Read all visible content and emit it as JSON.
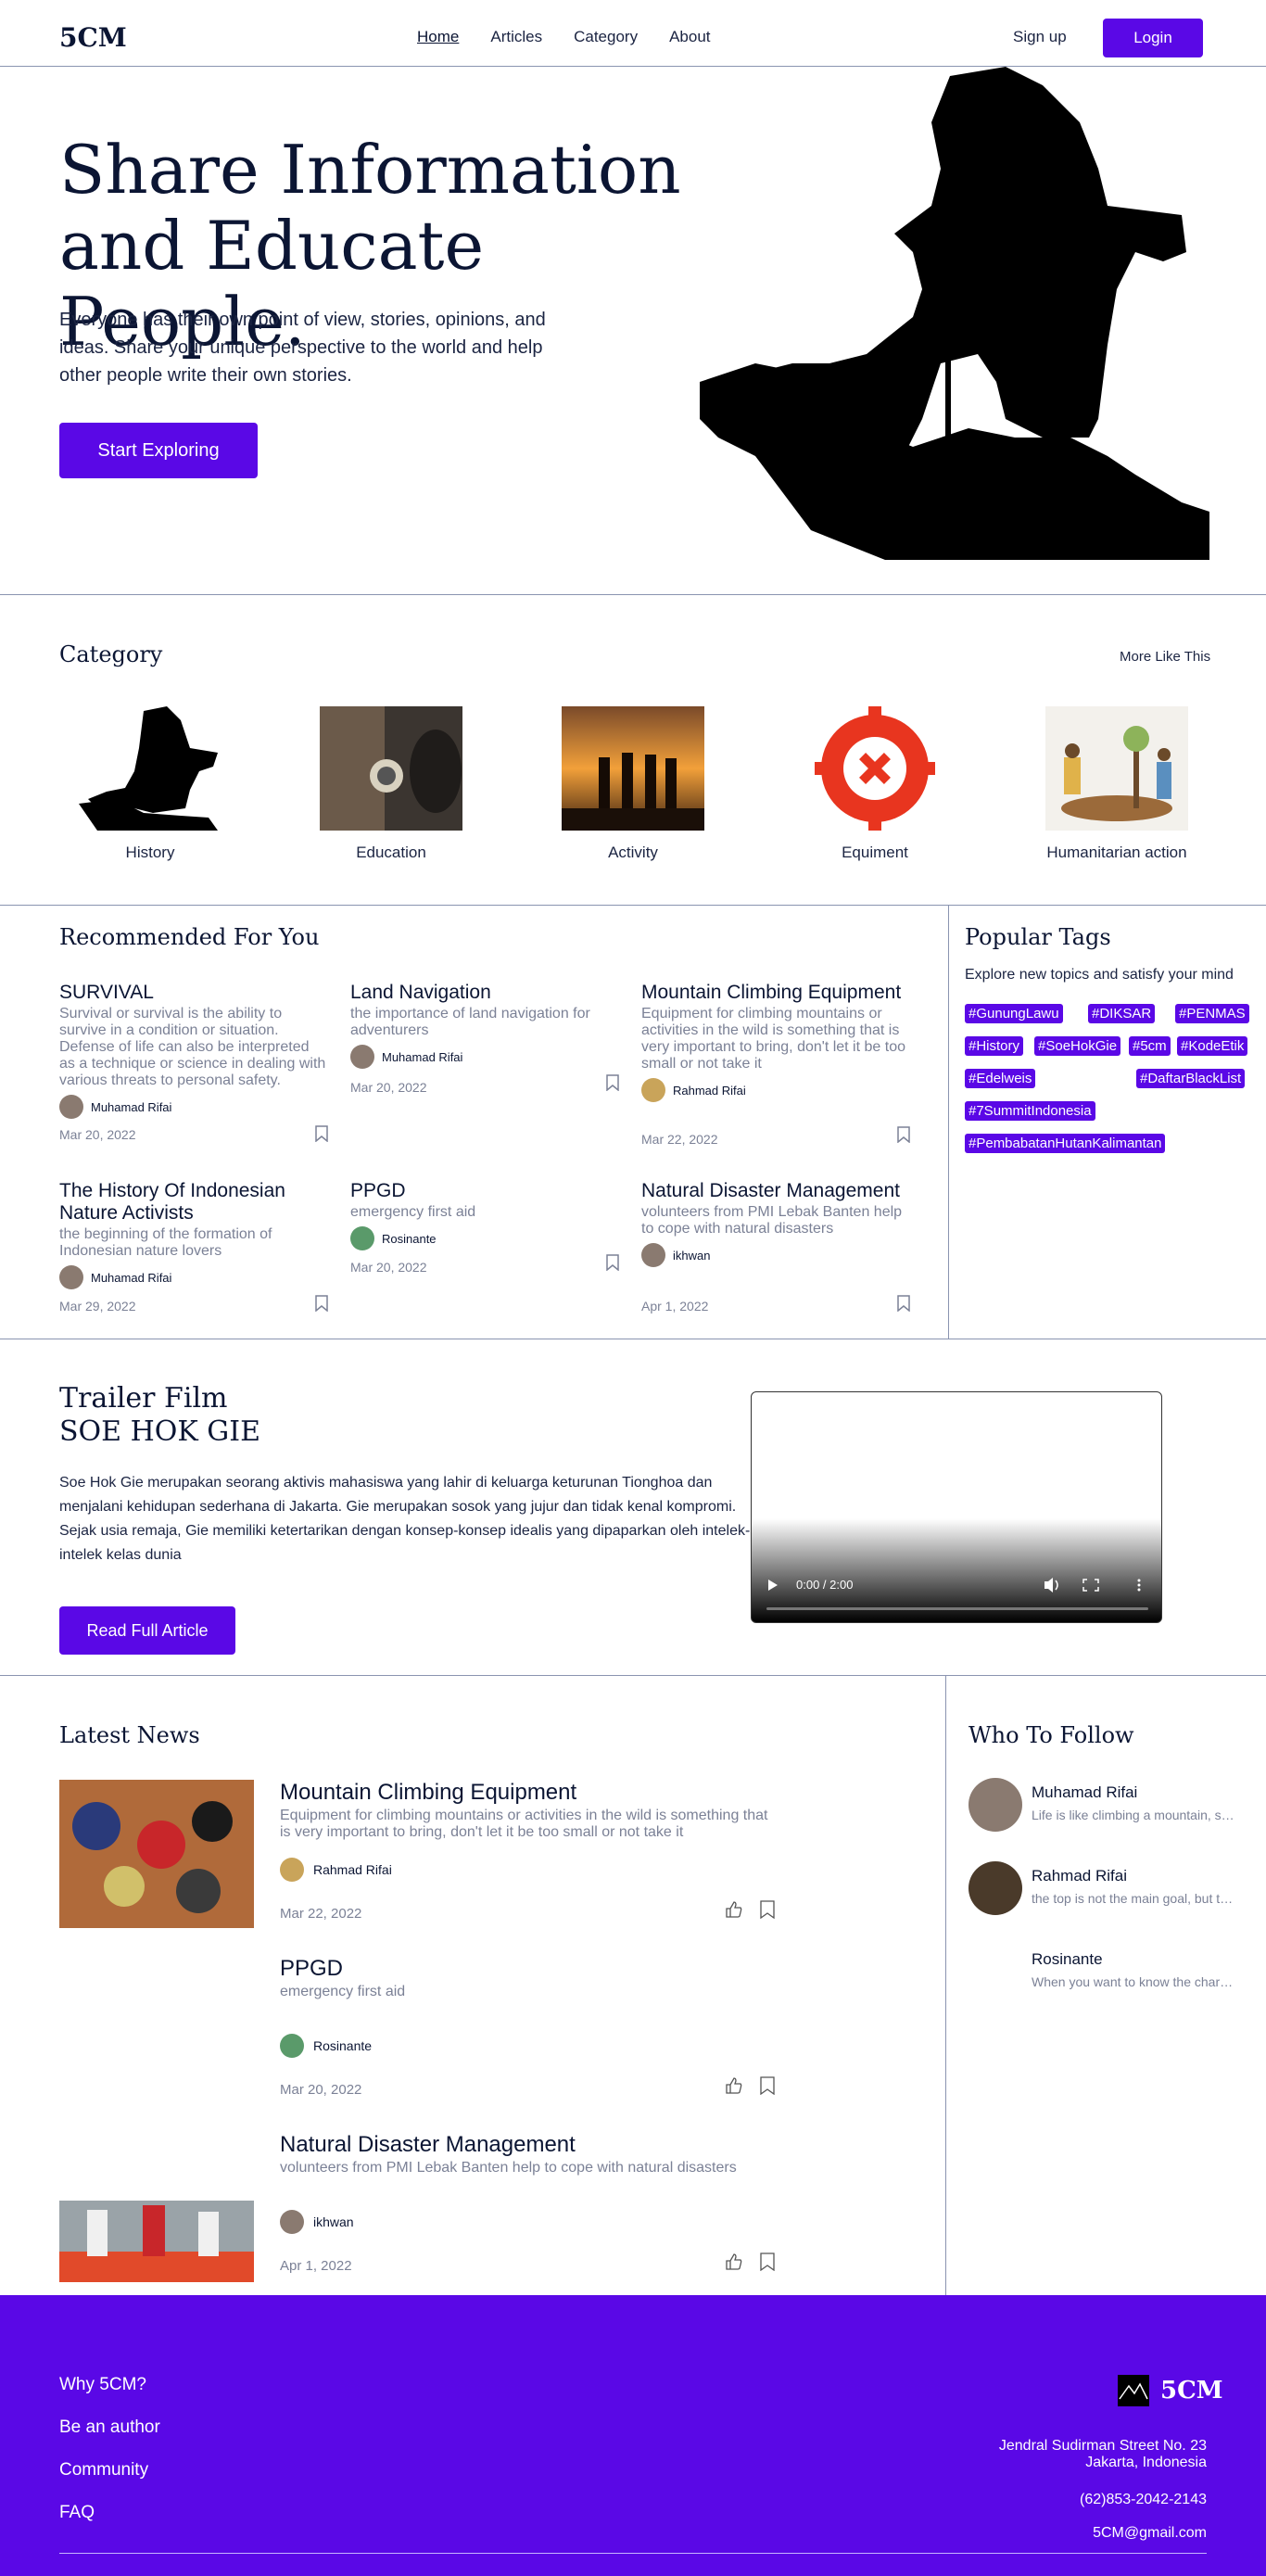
{
  "header": {
    "logo": "5CM",
    "nav": [
      "Home",
      "Articles",
      "Category",
      "About"
    ],
    "signup": "Sign up",
    "login": "Login"
  },
  "hero": {
    "title": "Share Information and Educate People.",
    "text": "Everyone has their own point of view, stories, opinions, and ideas. Share your unique perspective to the world and help other people write their own stories.",
    "button": "Start Exploring"
  },
  "category": {
    "title": "Category",
    "more": "More Like This",
    "items": [
      "History",
      "Education",
      "Activity",
      "Equiment",
      "Humanitarian action"
    ]
  },
  "recommended": {
    "title": "Recommended For You",
    "cards": [
      {
        "title": "SURVIVAL",
        "desc": "Survival or survival is the ability to survive in a condition or situation. Defense of life can also be interpreted as a technique or science in dealing with various threats to personal safety.",
        "author": "Muhamad Rifai",
        "date": "Mar 20, 2022"
      },
      {
        "title": "Land Navigation",
        "desc": "the importance of land navigation for adventurers",
        "author": "Muhamad Rifai",
        "date": "Mar 20, 2022"
      },
      {
        "title": "Mountain Climbing Equipment",
        "desc": "Equipment for climbing mountains or activities in the wild is something that is very important to bring, don't let it be too small or not take it",
        "author": "Rahmad Rifai",
        "date": "Mar 22, 2022"
      },
      {
        "title": "The History Of Indonesian Nature Activists",
        "desc": "the beginning of the formation of Indonesian nature lovers",
        "author": "Muhamad Rifai",
        "date": "Mar 29, 2022"
      },
      {
        "title": "PPGD",
        "desc": "emergency first aid",
        "author": "Rosinante",
        "date": "Mar 20, 2022"
      },
      {
        "title": "Natural Disaster Management",
        "desc": "volunteers from PMI Lebak Banten help to cope with natural disasters",
        "author": "ikhwan",
        "date": "Apr 1, 2022"
      }
    ]
  },
  "popular": {
    "title": "Popular Tags",
    "subtitle": "Explore new topics and satisfy your mind",
    "tags": [
      "#GunungLawu",
      "#DIKSAR",
      "#PENMAS",
      "#History",
      "#SoeHokGie",
      "#5cm",
      "#KodeEtik",
      "#Edelweis",
      "#DaftarBlackList",
      "#7SummitIndonesia",
      "#PembabatanHutanKalimantan"
    ]
  },
  "trailer": {
    "title1": "Trailer Film",
    "title2": "SOE HOK GIE",
    "p1": "Soe Hok Gie merupakan seorang aktivis mahasiswa yang lahir di keluarga keturunan Tionghoa dan menjalani kehidupan sederhana di Jakarta. Gie merupakan sosok yang jujur dan tidak kenal kompromi.",
    "p2": "Sejak usia remaja, Gie memiliki ketertarikan dengan konsep-konsep idealis yang dipaparkan oleh intelek-intelek kelas dunia",
    "button": "Read Full Article",
    "video_time": "0:00 / 2:00"
  },
  "latest": {
    "title": "Latest News",
    "items": [
      {
        "title": "Mountain Climbing Equipment",
        "desc": "Equipment for climbing mountains or activities in the wild is something that is very important to bring, don't let it be too small or not take it",
        "author": "Rahmad Rifai",
        "date": "Mar 22, 2022"
      },
      {
        "title": "PPGD",
        "desc": "emergency first aid",
        "author": "Rosinante",
        "date": "Mar 20, 2022"
      },
      {
        "title": "Natural Disaster Management",
        "desc": "volunteers from PMI Lebak Banten help to cope with natural disasters",
        "author": "ikhwan",
        "date": "Apr 1, 2022"
      }
    ]
  },
  "who": {
    "title": "Who To Follow",
    "people": [
      {
        "name": "Muhamad Rifai",
        "bio": "Life is like climbing a mountain, step by step"
      },
      {
        "name": "Rahmad Rifai",
        "bio": "the top is not the main goal, but the journey"
      },
      {
        "name": "Rosinante",
        "bio": "When you want to know the character of someone"
      }
    ]
  },
  "footer": {
    "links": [
      "Why 5CM?",
      "Be an author",
      "Community",
      "FAQ"
    ],
    "logo": "5CM",
    "address1": "Jendral Sudirman Street No. 23",
    "address2": "Jakarta, Indonesia",
    "phone": "(62)853-2042-2143",
    "email": "5CM@gmail.com"
  },
  "colors": {
    "accent": "#5a08e6",
    "text": "#0b1533",
    "muted": "#7b8196",
    "divider": "#8a94b0"
  }
}
